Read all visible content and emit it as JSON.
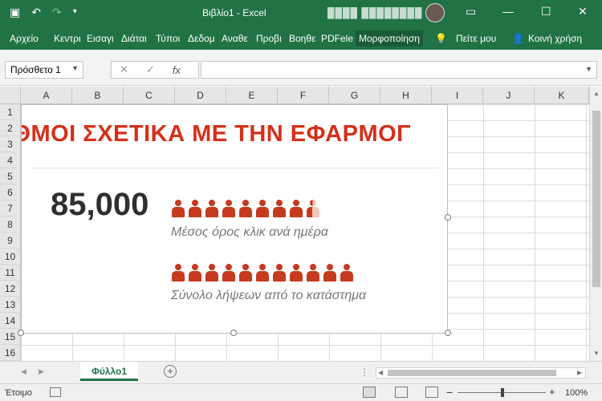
{
  "titlebar": {
    "title": "Βιβλίο1 - Excel",
    "user": "████ ████████",
    "icons": [
      "save-icon",
      "undo-icon",
      "redo-icon",
      "customize-icon"
    ],
    "window_controls": [
      "ribbon-display-icon",
      "minimize-icon",
      "maximize-icon",
      "close-icon"
    ]
  },
  "ribbon": {
    "tabs": [
      "Αρχείο",
      "Κεντρι",
      "Εισαγι",
      "Διάται",
      "Τύποι",
      "Δεδομ",
      "Αναθε",
      "Προβι",
      "Βοηθε",
      "PDFele",
      "Μορφοποίηση"
    ],
    "tell_me": "Πείτε μου",
    "share": "Κοινή χρήση"
  },
  "formula_bar": {
    "name_box": "Πρόσθετο 1",
    "cancel": "✕",
    "enter": "✓",
    "fx": "fx",
    "value": ""
  },
  "columns": [
    "A",
    "B",
    "C",
    "D",
    "E",
    "F",
    "G",
    "H",
    "I",
    "J",
    "K"
  ],
  "rows": [
    "1",
    "2",
    "3",
    "4",
    "5",
    "6",
    "7",
    "8",
    "9",
    "10",
    "11",
    "12",
    "13",
    "14",
    "15",
    "16"
  ],
  "infographic": {
    "title": "ΡΙΘΜΟΙ ΣΧΕΤΙΚΑ ΜΕ ΤΗΝ ΕΦΑΡΜΟΓ",
    "big_number": "85,000",
    "caption1": "Μέσος όρος κλικ ανά ημέρα",
    "caption2": "Σύνολο λήψεων από το κατάστημα",
    "row1_people": 8.5,
    "row2_people": 11,
    "accent": "#c63a1d"
  },
  "sheets": {
    "tabs": [
      "Φύλλο1"
    ],
    "add": "+"
  },
  "statusbar": {
    "ready": "Έτοιμο",
    "zoom": "100%",
    "zoom_minus": "−",
    "zoom_plus": "+"
  }
}
